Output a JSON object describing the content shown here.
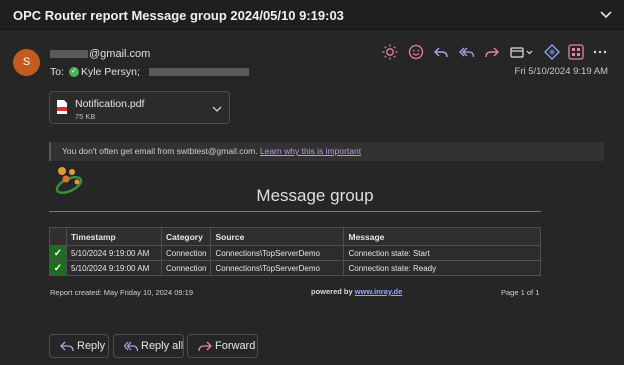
{
  "header": {
    "subject": "OPC Router report Message group 2024/05/10 9:19:03"
  },
  "sender": {
    "avatar_initial": "S",
    "email_suffix": "@gmail.com",
    "to_label": "To:",
    "to_name": "Kyle Persyn;",
    "date": "Fri 5/10/2024 9:19 AM"
  },
  "attachment": {
    "name": "Notification.pdf",
    "size": "75 KB"
  },
  "notice": {
    "text": "You don't often get email from swtbtest@gmail.com.",
    "link": "Learn why this is important"
  },
  "report": {
    "title": "Message group",
    "columns": [
      "Timestamp",
      "Category",
      "Source",
      "Message"
    ],
    "rows": [
      {
        "timestamp": "5/10/2024 9:19:00 AM",
        "category": "Connection",
        "source": "Connections\\TopServerDemo",
        "message": "Connection state: Start"
      },
      {
        "timestamp": "5/10/2024 9:19:00 AM",
        "category": "Connection",
        "source": "Connections\\TopServerDemo",
        "message": "Connection state: Ready"
      }
    ],
    "row_status_icon": "checkmark",
    "created": "Report created: May Friday 10, 2024 09:19",
    "powered_by": "powered by",
    "powered_by_brand": "www.inray.de",
    "page": "Page 1 of 1"
  },
  "buttons": {
    "reply": "Reply",
    "reply_all": "Reply all",
    "forward": "Forward"
  },
  "colors": {
    "accent_purple": "#b69be6",
    "toolbar_pink": "#e97fae",
    "success_green": "#54b054"
  }
}
